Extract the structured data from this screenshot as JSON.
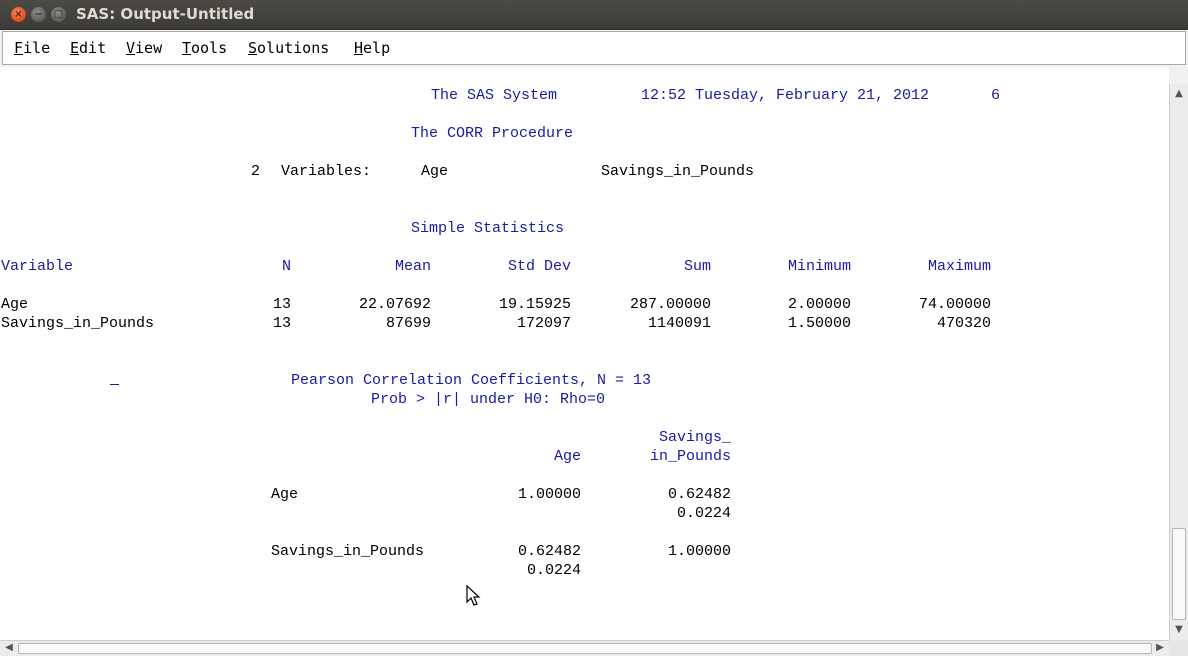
{
  "window": {
    "title": "SAS: Output-Untitled",
    "close_glyph": "×",
    "min_glyph": "−",
    "max_glyph": "□"
  },
  "menu": {
    "file": {
      "u": "F",
      "rest": "ile"
    },
    "edit": {
      "u": "E",
      "rest": "dit"
    },
    "view": {
      "u": "V",
      "rest": "iew"
    },
    "tools": {
      "u": "T",
      "rest": "ools"
    },
    "solutions": {
      "u": "S",
      "rest": "olutions"
    },
    "help": {
      "u": "H",
      "rest": "elp"
    }
  },
  "output": {
    "header_title": "The SAS System",
    "header_datetime": "12:52 Tuesday, February 21, 2012",
    "header_page": "6",
    "procedure": "The CORR Procedure",
    "variables_line": {
      "count": "2",
      "label": "Variables:",
      "var1": "Age",
      "var2": "Savings_in_Pounds"
    },
    "simple_stats_title": "Simple Statistics",
    "stats_headers": [
      "Variable",
      "N",
      "Mean",
      "Std Dev",
      "Sum",
      "Minimum",
      "Maximum"
    ],
    "stats_rows": [
      [
        "Age",
        "13",
        "22.07692",
        "19.15925",
        "287.00000",
        "2.00000",
        "74.00000"
      ],
      [
        "Savings_in_Pounds",
        "13",
        "87699",
        "172097",
        "1140091",
        "1.50000",
        "470320"
      ]
    ],
    "pearson_title": "Pearson Correlation Coefficients, N = 13",
    "pearson_subtitle": "Prob > |r| under H0: Rho=0",
    "corr_col_headers": {
      "age": "Age",
      "savings_top": "Savings_",
      "savings_bottom": "in_Pounds"
    },
    "corr_rows": [
      {
        "label": "Age",
        "r_age": "1.00000",
        "r_sav": "0.62482",
        "p_age": "",
        "p_sav": "0.0224"
      },
      {
        "label": "Savings_in_Pounds",
        "r_age": "0.62482",
        "r_sav": "1.00000",
        "p_age": "0.0224",
        "p_sav": ""
      }
    ]
  },
  "colors": {
    "title_text": "#dfdbd2",
    "output_blue": "#1a1aa6",
    "output_black": "#000000"
  }
}
